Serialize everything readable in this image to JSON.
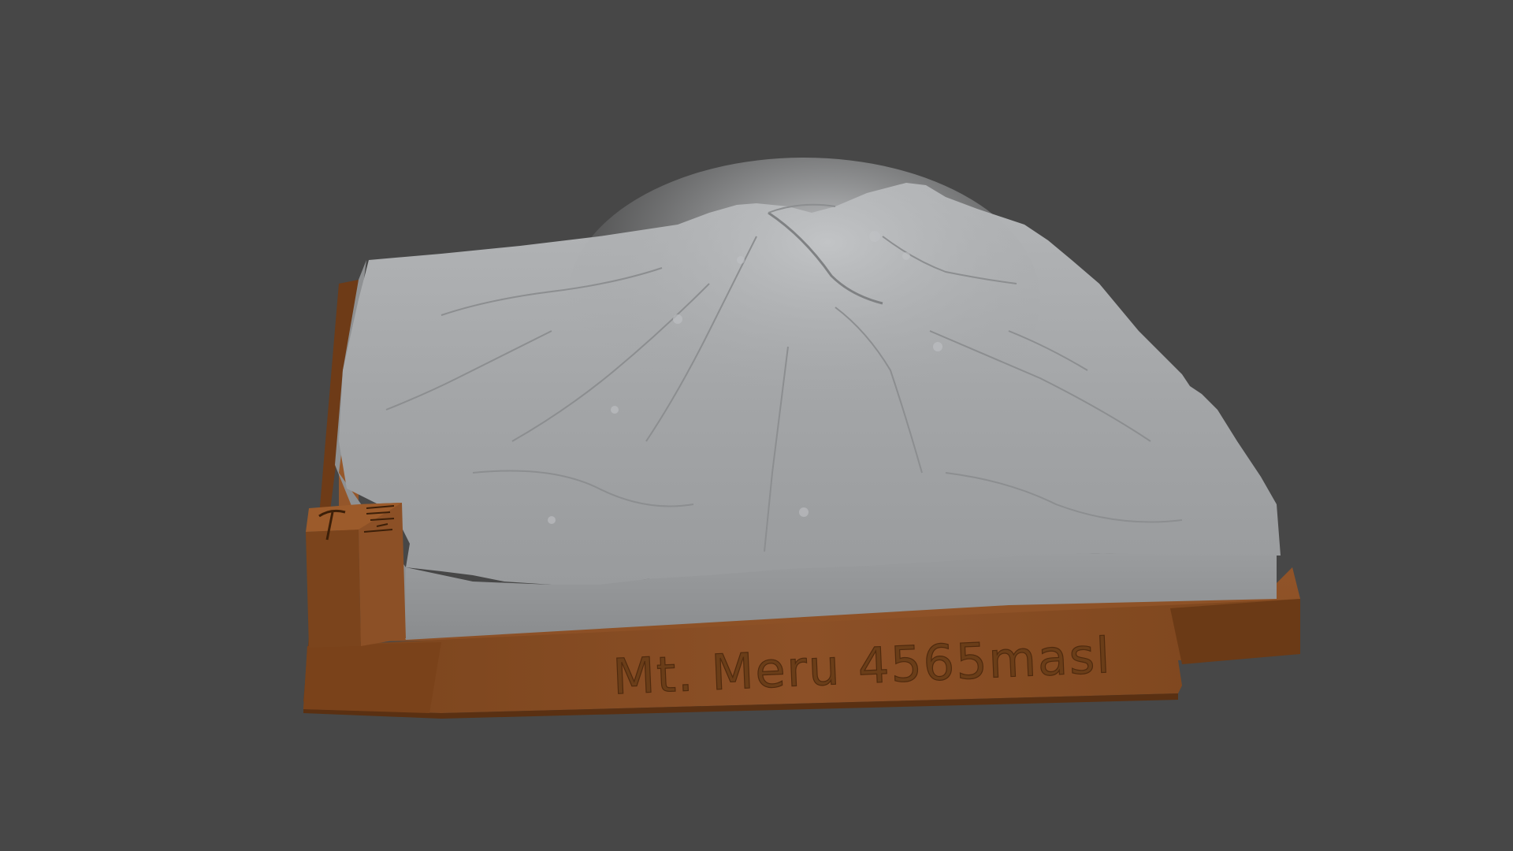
{
  "viewport": {
    "background_color": "#474747"
  },
  "model": {
    "name": "terrain-relief-model",
    "base_color": "#8a4f23",
    "base_shadow_color": "#5e3315",
    "terrain_color": "#a9abad",
    "terrain_side_color": "#8d8f90",
    "label_text": "Mt. Meru 4565masl",
    "side_block_icons": [
      "pickaxe-icon",
      "contour-lines-icon"
    ]
  }
}
